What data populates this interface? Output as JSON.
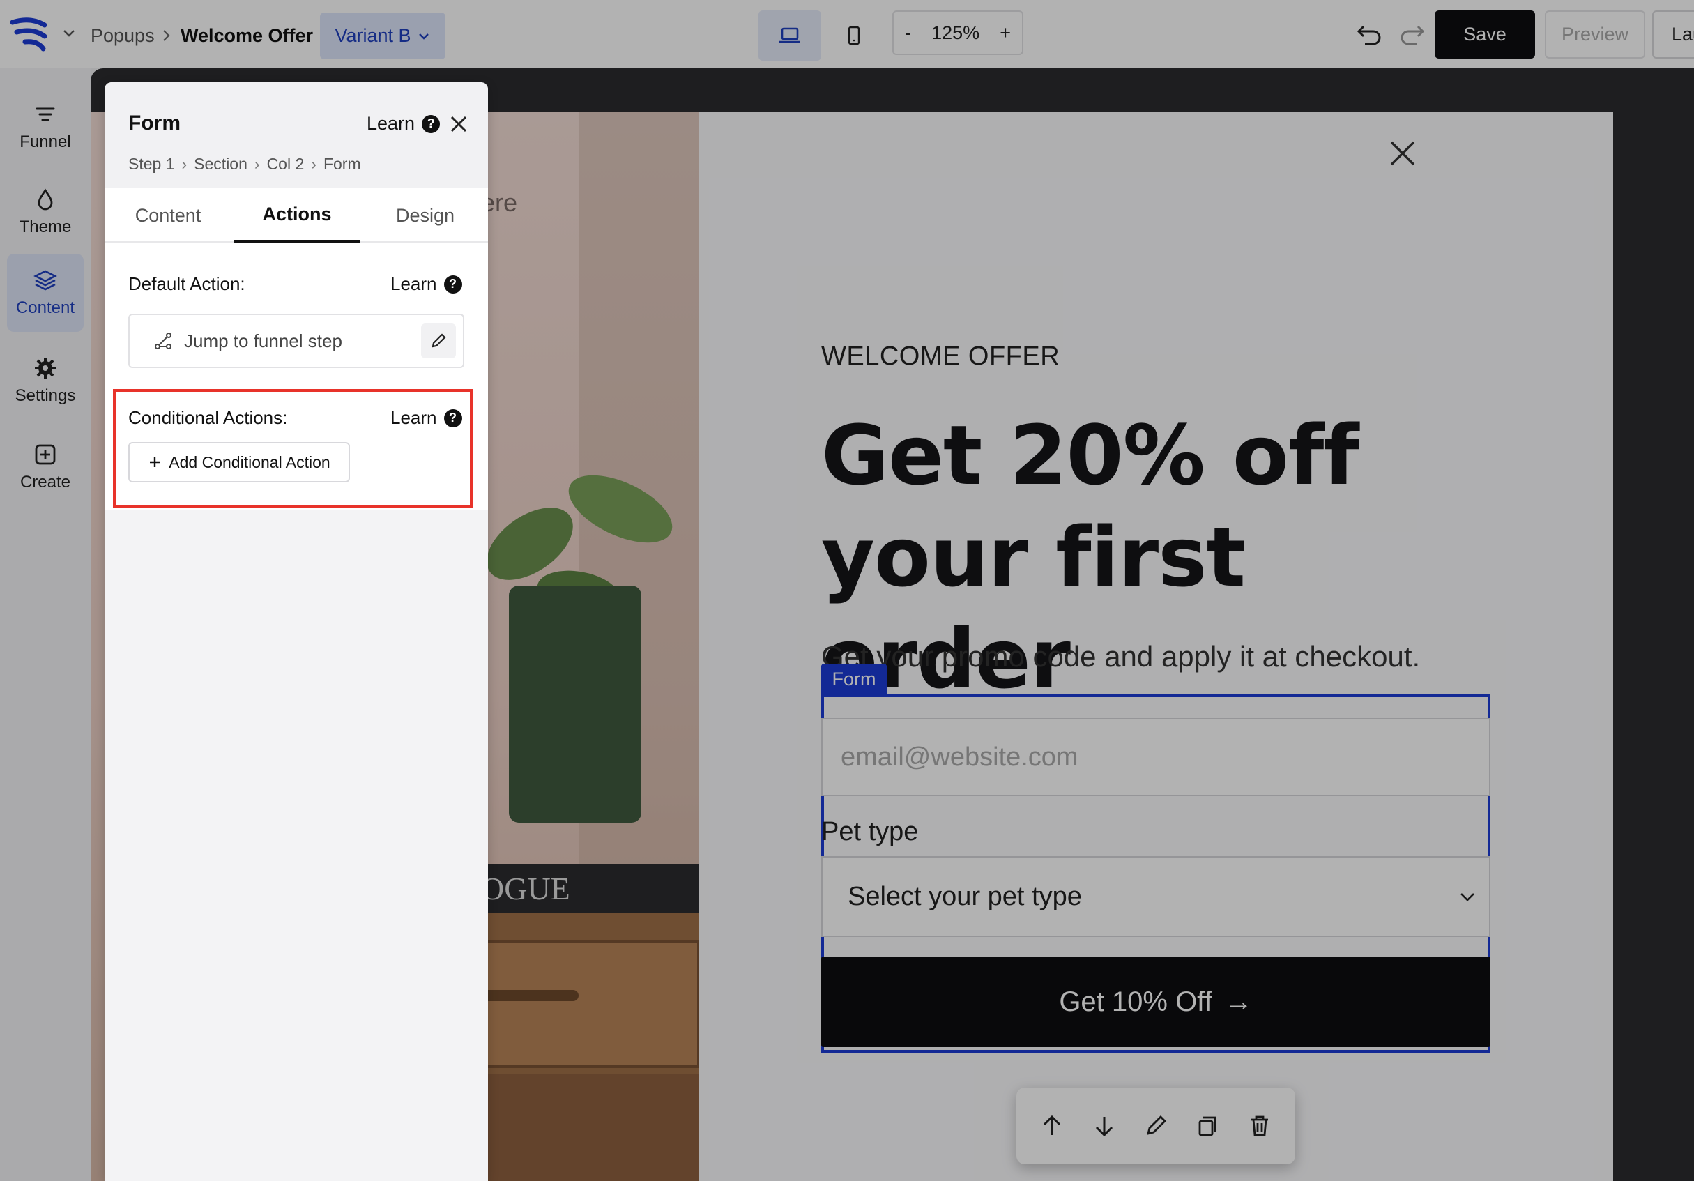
{
  "header": {
    "breadcrumb_parent": "Popups",
    "breadcrumb_current": "Welcome Offer",
    "variant": "Variant B",
    "zoom_minus": "-",
    "zoom_value": "125%",
    "zoom_plus": "+",
    "save_label": "Save",
    "preview_label": "Preview",
    "launch_label": "Lau"
  },
  "rail": {
    "items": [
      {
        "label": "Funnel",
        "icon": "funnel-icon"
      },
      {
        "label": "Theme",
        "icon": "droplet-icon"
      },
      {
        "label": "Content",
        "icon": "layers-icon",
        "active": true
      },
      {
        "label": "Settings",
        "icon": "gear-icon"
      },
      {
        "label": "Create",
        "icon": "plus-square-icon"
      }
    ]
  },
  "panel": {
    "title": "Form",
    "learn": "Learn",
    "help_glyph": "?",
    "crumbs": [
      "Step 1",
      "Section",
      "Col 2",
      "Form"
    ],
    "tabs": [
      "Content",
      "Actions",
      "Design"
    ],
    "active_tab": "Actions",
    "default_action_label": "Default Action:",
    "default_action_value": "Jump to funnel step",
    "conditional_label": "Conditional Actions:",
    "add_conditional": "Add Conditional Action"
  },
  "popup": {
    "photo_text": "ere",
    "photo_book_text": "OGUE",
    "eyebrow": "WELCOME OFFER",
    "headline_line1": "Get 20% off",
    "headline_line2": "your first order",
    "subtext": "Get your promo code and apply it at checkout.",
    "form_tag": "Form",
    "email_placeholder": "email@website.com",
    "pet_label": "Pet type",
    "pet_select": "Select your pet type",
    "cta_label": "Get 10% Off",
    "cta_arrow": "→"
  },
  "colors": {
    "accent": "#1c3bd6",
    "highlight": "#e8332a",
    "dark": "#0d0d10"
  }
}
